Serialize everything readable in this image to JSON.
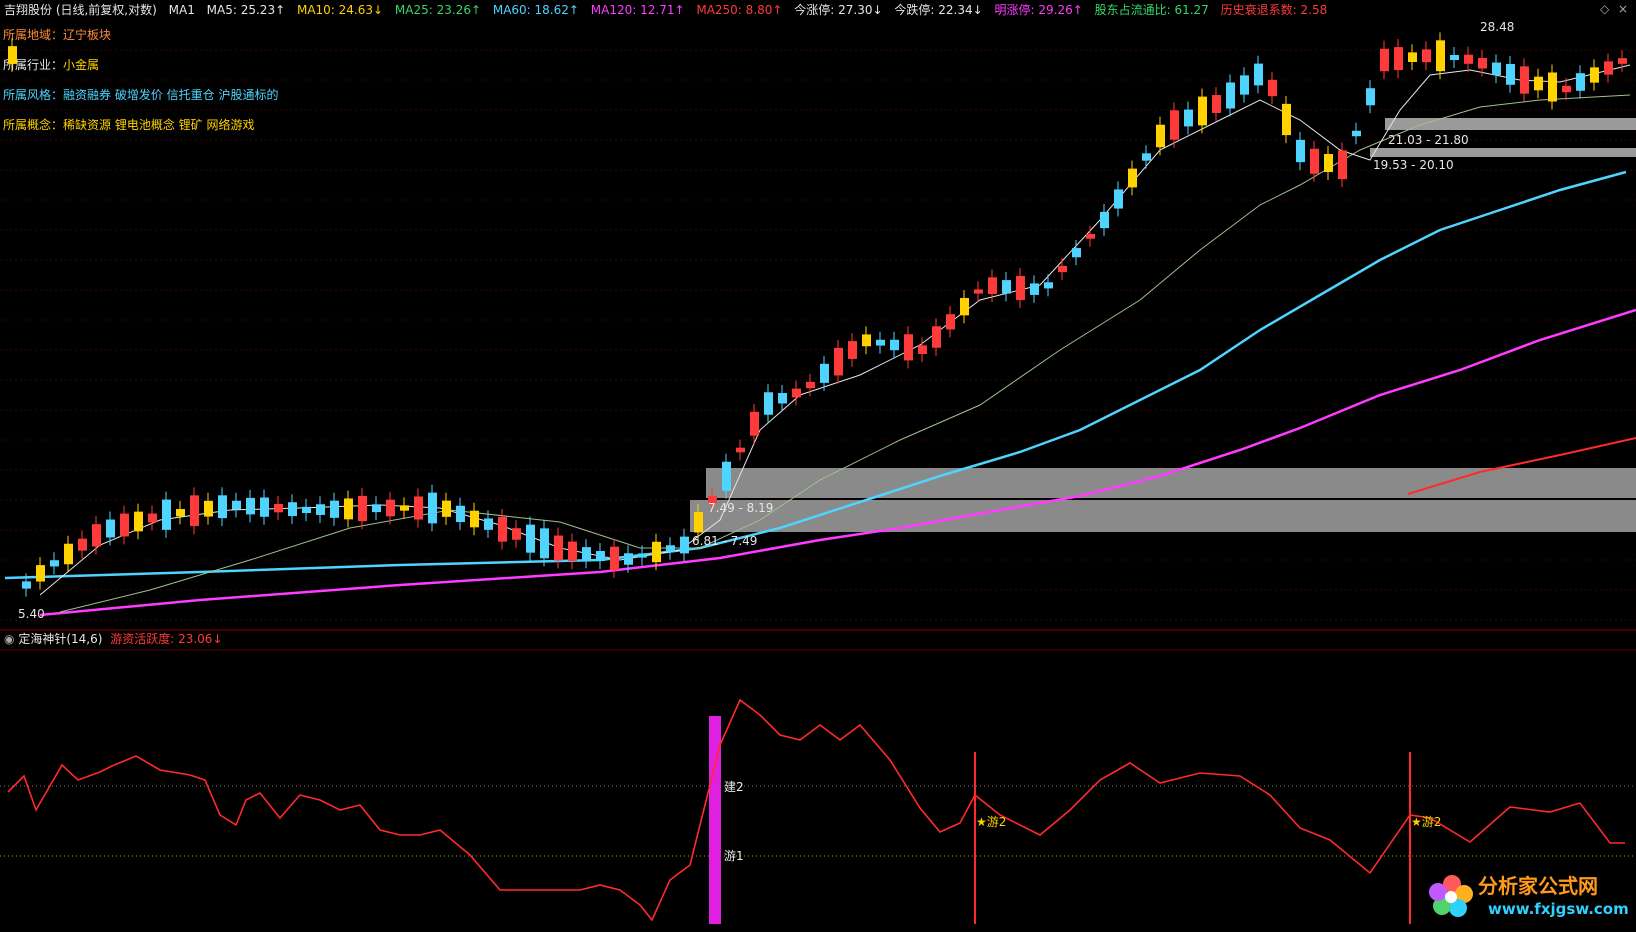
{
  "header": {
    "stock": "吉翔股份 (日线,前复权,对数)",
    "indicator": "MA1",
    "ma5": "MA5: 25.23↑",
    "ma10": "MA10: 24.63↓",
    "ma25": "MA25: 23.26↑",
    "ma60": "MA60: 18.62↑",
    "ma120": "MA120: 12.71↑",
    "ma250": "MA250: 8.80↑",
    "zt": "今涨停: 27.30↓",
    "dt": "今跌停: 22.34↓",
    "mzt": "明涨停: 29.26↑",
    "gd": "股东占流通比: 61.27",
    "ls": "历史衰退系数: 2.58",
    "colors": {
      "white": "#e6e6e6",
      "yellow": "#ffd200",
      "green": "#36d66b",
      "cyan": "#4fd3ff",
      "magenta": "#ff3cff",
      "red": "#ff3a3a",
      "orange": "#ff8a3a"
    }
  },
  "info": {
    "region_key": "所属地域：",
    "region_val": "辽宁板块",
    "industry_key": "所属行业：",
    "industry_val": "小金属",
    "style_key": "所属风格：",
    "style_val": "融资融券 破增发价 信托重仓 沪股通标的",
    "concept_key": "所属概念：",
    "concept_val": "稀缺资源 锂电池概念 锂矿 网络游戏"
  },
  "price_labels": {
    "high": "28.48",
    "low": "5.40",
    "zone1": "21.03 - 21.80",
    "zone2": "19.53 - 20.10",
    "zone3": "7.49 - 8.19",
    "zone4": "6.81 - 7.49"
  },
  "sub": {
    "name": "定海神针(14,6)",
    "value": "游资活跃度: 23.06↓",
    "marks": {
      "jian": "建2",
      "you1": "游1",
      "you2a": "★游2",
      "you2b": "★游2"
    }
  },
  "corner_icons": [
    "diamond-icon",
    "close-icon"
  ],
  "logo": {
    "cn": "分析家公式网",
    "url": "www.fxjgsw.com"
  }
}
